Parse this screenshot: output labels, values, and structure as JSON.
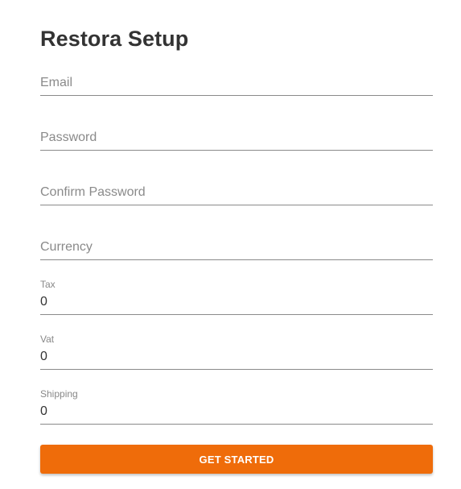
{
  "form": {
    "title": "Restora Setup",
    "email": {
      "placeholder": "Email",
      "value": ""
    },
    "password": {
      "placeholder": "Password",
      "value": ""
    },
    "confirm_password": {
      "placeholder": "Confirm Password",
      "value": ""
    },
    "currency": {
      "placeholder": "Currency",
      "value": ""
    },
    "tax": {
      "label": "Tax",
      "value": "0"
    },
    "vat": {
      "label": "Vat",
      "value": "0"
    },
    "shipping": {
      "label": "Shipping",
      "value": "0"
    },
    "submit_label": "GET STARTED"
  },
  "colors": {
    "accent": "#ef6c0a",
    "text": "#333333",
    "muted": "#8a8a8a"
  }
}
